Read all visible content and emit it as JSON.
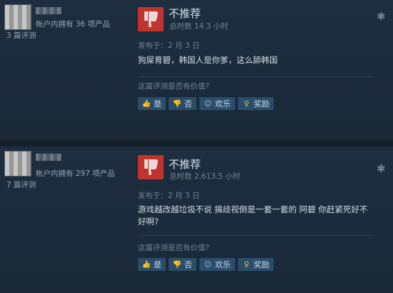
{
  "reviews": [
    {
      "owned": "帐户内拥有 36 项产品",
      "review_count": "3 篇评测",
      "verdict": "不推荐",
      "hours": "总时数 14.3 小时",
      "posted": "发布于：2 月 3 日",
      "text": "狗屎育碧，韩国人是你爹，这么舔韩国",
      "helpful_prompt": "这篇评测是否有价值?",
      "buttons": {
        "yes": "是",
        "no": "否",
        "funny": "欢乐",
        "award": "奖励"
      }
    },
    {
      "owned": "帐户内拥有 297 项产品",
      "review_count": "7 篇评测",
      "verdict": "不推荐",
      "hours": "总时数 2,613.5 小时",
      "posted": "发布于：2 月 3 日",
      "text": "游戏越改越垃圾不说 搞歧视倒是一套一套的 阿碧 你赶紧死好不好啊?",
      "helpful_prompt": "这篇评测是否有价值?",
      "buttons": {
        "yes": "是",
        "no": "否",
        "funny": "欢乐",
        "award": "奖励"
      }
    }
  ],
  "colors": {
    "thumb_down_bg": "#c1332d",
    "button_bg": "#2a4d6b",
    "page_bg": "#1b2838"
  },
  "icons": {
    "verdict": "thumbs-down-icon",
    "menu": "star-icon",
    "yes": "thumbs-up-icon",
    "no": "thumbs-down-icon",
    "funny": "smiley-icon",
    "award": "award-icon"
  }
}
